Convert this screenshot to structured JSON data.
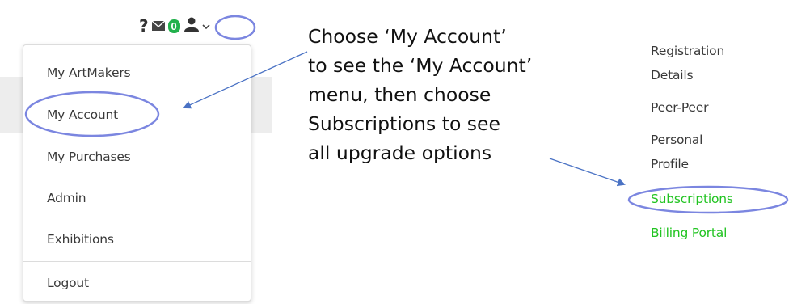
{
  "toolbar": {
    "help_icon_glyph": "?",
    "mail_icon": "envelope-icon",
    "notification_count": "0",
    "user_icon": "user-icon",
    "dropdown_icon": "chevron-down-icon",
    "badge_color": "#22b14c"
  },
  "dropdown": {
    "items": [
      {
        "label": "My ArtMakers"
      },
      {
        "label": "My Account"
      },
      {
        "label": "My Purchases"
      },
      {
        "label": "Admin"
      },
      {
        "label": "Exhibitions"
      },
      {
        "label": "Logout"
      }
    ]
  },
  "callout": {
    "lines": [
      "Choose ‘My Account’",
      "to see the ‘My Account’",
      "menu, then choose",
      "Subscriptions to see",
      "all upgrade options"
    ]
  },
  "submenu": {
    "items": [
      {
        "label": "Registration"
      },
      {
        "label": "Details"
      },
      {
        "label": "Peer-Peer"
      },
      {
        "label": "Personal"
      },
      {
        "label": "Profile"
      },
      {
        "label": "Subscriptions"
      },
      {
        "label": "Billing Portal"
      }
    ],
    "highlight_color": "#22c422",
    "circle_color": "#7b86e0",
    "arrow_color": "#4a72c4"
  }
}
